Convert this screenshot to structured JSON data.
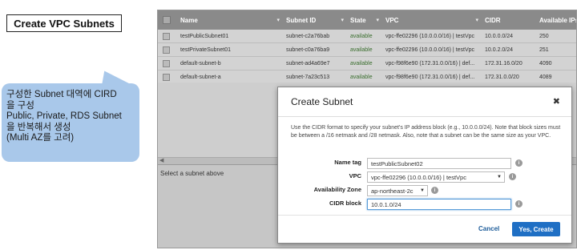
{
  "annotation": {
    "title": "Create VPC Subnets",
    "bubble_text": "구성한 Subnet 대역에 CIRD\n을 구성\nPublic, Private, RDS Subnet\n을 반복해서 생성\n(Multi AZ를 고려)"
  },
  "table": {
    "columns": [
      "Name",
      "Subnet ID",
      "State",
      "VPC",
      "CIDR",
      "Available IPs"
    ],
    "rows": [
      {
        "name": "testPublicSubnet01",
        "subnet_id": "subnet-c2a76bab",
        "state": "available",
        "vpc": "vpc-ffe02296 (10.0.0.0/16) | testVpc",
        "cidr": "10.0.0.0/24",
        "ips": "250"
      },
      {
        "name": "testPrivateSubnet01",
        "subnet_id": "subnet-c0a76ba9",
        "state": "available",
        "vpc": "vpc-ffe02296 (10.0.0.0/16) | testVpc",
        "cidr": "10.0.2.0/24",
        "ips": "251"
      },
      {
        "name": "default-subnet-b",
        "subnet_id": "subnet-ad4a69e7",
        "state": "available",
        "vpc": "vpc-f98f6e90 (172.31.0.0/16) | def...",
        "cidr": "172.31.16.0/20",
        "ips": "4090"
      },
      {
        "name": "default-subnet-a",
        "subnet_id": "subnet-7a23c513",
        "state": "available",
        "vpc": "vpc-f98f6e90 (172.31.0.0/16) | def...",
        "cidr": "172.31.0.0/20",
        "ips": "4089"
      }
    ]
  },
  "detail": {
    "placeholder": "Select a subnet above"
  },
  "dialog": {
    "title": "Create Subnet",
    "close": "✖",
    "description": "Use the CIDR format to specify your subnet's IP address block (e.g., 10.0.0.0/24). Note that block sizes must be between a /16 netmask and /28 netmask. Also, note that a subnet can be the same size as your VPC.",
    "fields": {
      "name_tag_label": "Name tag",
      "name_tag_value": "testPublicSubnet02",
      "vpc_label": "VPC",
      "vpc_value": "vpc-ffe02296 (10.0.0.0/16) | testVpc",
      "az_label": "Availability Zone",
      "az_value": "ap-northeast-2c",
      "cidr_label": "CIDR block",
      "cidr_value": "10.0.1.0/24"
    },
    "cancel_label": "Cancel",
    "create_label": "Yes, Create"
  }
}
